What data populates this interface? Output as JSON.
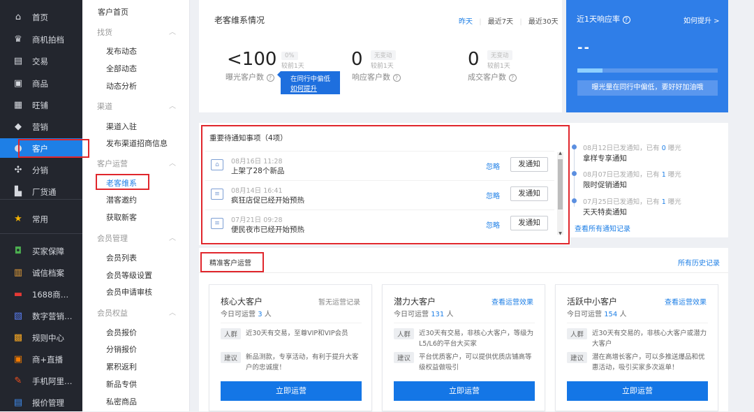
{
  "nav": {
    "items": [
      {
        "label": "首页",
        "icon": "home-icon",
        "glyph": "⌂"
      },
      {
        "label": "商机拍档",
        "icon": "crown-icon",
        "glyph": "♛"
      },
      {
        "label": "交易",
        "icon": "document-icon",
        "glyph": "▤"
      },
      {
        "label": "商品",
        "icon": "box-icon",
        "glyph": "▣"
      },
      {
        "label": "旺铺",
        "icon": "shop-icon",
        "glyph": "▦"
      },
      {
        "label": "营销",
        "icon": "tag-icon",
        "glyph": "◆"
      },
      {
        "label": "客户",
        "icon": "user-icon",
        "glyph": "●"
      },
      {
        "label": "分销",
        "icon": "share-icon",
        "glyph": "✣"
      },
      {
        "label": "厂货通",
        "icon": "factory-icon",
        "glyph": "▙"
      },
      {
        "label": "常用",
        "icon": "star-icon",
        "glyph": "★"
      },
      {
        "label": "买家保障",
        "icon": "shield-icon",
        "glyph": "◘"
      },
      {
        "label": "诚信档案",
        "icon": "file-icon",
        "glyph": "▥"
      },
      {
        "label": "1688商…",
        "icon": "tv-icon",
        "glyph": "▬"
      },
      {
        "label": "数字营销…",
        "icon": "chart-icon",
        "glyph": "▧"
      },
      {
        "label": "规则中心",
        "icon": "rules-icon",
        "glyph": "▩"
      },
      {
        "label": "商+直播",
        "icon": "live-icon",
        "glyph": "▣"
      },
      {
        "label": "手机阿里…",
        "icon": "phone-icon",
        "glyph": "✎"
      },
      {
        "label": "报价管理",
        "icon": "quote-icon",
        "glyph": "▤"
      }
    ]
  },
  "subnav": {
    "top": "客户首页",
    "groups": [
      {
        "title": "找货",
        "items": [
          "发布动态",
          "全部动态",
          "动态分析"
        ]
      },
      {
        "title": "渠道",
        "items": [
          "渠道入驻",
          "发布渠道招商信息"
        ]
      },
      {
        "title": "客户运营",
        "items": [
          "老客维系",
          "潜客邀约",
          "获取新客"
        ]
      },
      {
        "title": "会员管理",
        "items": [
          "会员列表",
          "会员等级设置",
          "会员申请审核"
        ]
      },
      {
        "title": "会员权益",
        "items": [
          "会员报价",
          "分销报价",
          "累积返利",
          "新品专供",
          "私密商品"
        ]
      }
    ]
  },
  "overview": {
    "title": "老客维系情况",
    "tabs": [
      "昨天",
      "最近7天",
      "最近30天"
    ],
    "metrics": [
      {
        "value": "<100",
        "badge": "0%",
        "compare": "较前1天",
        "label": "曝光客户数"
      },
      {
        "value": "0",
        "badge": "无变动",
        "compare": "较前1天",
        "label": "响应客户数"
      },
      {
        "value": "0",
        "badge": "无变动",
        "compare": "较前1天",
        "label": "成交客户数"
      }
    ],
    "tooltip_line1": "在同行中偏低",
    "tooltip_line2": "如何提升"
  },
  "response": {
    "title": "近1天响应率",
    "help_link": "如何提升 >",
    "value": "--",
    "progress": 0.18,
    "banner": "曝光量在同行中偏低，要好好加油哦"
  },
  "notices": {
    "title": "重要待通知事项（4项）",
    "ignore_label": "忽略",
    "send_label": "发通知",
    "items": [
      {
        "time": "08月16日 11:28",
        "text": "上架了28个新品",
        "icon": "house-icon"
      },
      {
        "time": "08月14日 16:41",
        "text": "疯狂店促已经开始预热",
        "icon": "message-icon"
      },
      {
        "time": "07月21日 09:28",
        "text": "便民夜市已经开始预热",
        "icon": "message-icon"
      }
    ]
  },
  "history": {
    "items": [
      {
        "meta_prefix": "08月12日已发通知，已有 ",
        "count": "0",
        "meta_suffix": " 曝光",
        "title": "拿样专享通知"
      },
      {
        "meta_prefix": "08月07日已发通知，已有 ",
        "count": "1",
        "meta_suffix": " 曝光",
        "title": "限时促销通知"
      },
      {
        "meta_prefix": "07月25日已发通知，已有 ",
        "count": "1",
        "meta_suffix": " 曝光",
        "title": "天天特卖通知"
      }
    ],
    "link": "查看所有通知记录"
  },
  "precise": {
    "title": "精准客户运营",
    "history_link": "所有历史记录",
    "cards": [
      {
        "title": "核心大客户",
        "link": "暂无运营记录",
        "today_prefix": "今日可运营",
        "count": "3",
        "unit": "人",
        "crowd_tag": "人群",
        "crowd": "近30天有交易，至尊VIP和VIP会员",
        "advice_tag": "建议",
        "advice": "新品测款，专享活动，有利于提升大客户的忠诚度！",
        "button": "立即运营"
      },
      {
        "title": "潜力大客户",
        "link": "查看运营效果",
        "today_prefix": "今日可运营",
        "count": "131",
        "unit": "人",
        "crowd_tag": "人群",
        "crowd": "近30天有交易，非核心大客户，等级为L5/L6的平台大买家",
        "advice_tag": "建议",
        "advice": "平台优质客户，可以提供优质店铺高等级权益做吸引",
        "button": "立即运营"
      },
      {
        "title": "活跃中小客户",
        "link": "查看运营效果",
        "today_prefix": "今日可运营",
        "count": "154",
        "unit": "人",
        "crowd_tag": "人群",
        "crowd": "近30天有交易的，非核心大客户或潜力大客户",
        "advice_tag": "建议",
        "advice": "潜在高增长客户，可以多推送爆品和优惠活动，吸引买家多次返单！",
        "button": "立即运营"
      }
    ]
  }
}
